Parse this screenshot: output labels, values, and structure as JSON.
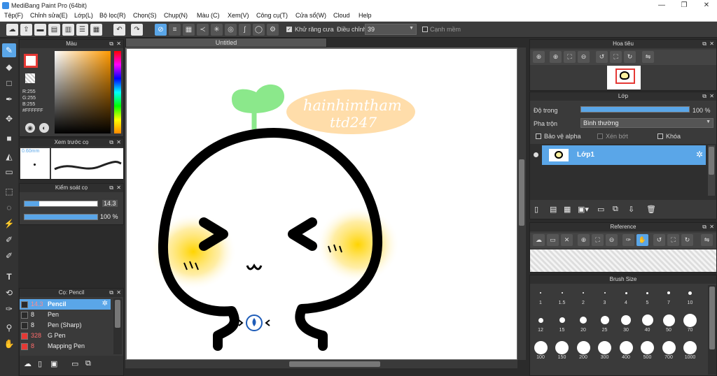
{
  "window": {
    "title": "MediBang Paint Pro (64bit)",
    "minimize": "—",
    "restore": "❐",
    "close": "✕"
  },
  "menu": [
    "Tệp(F)",
    "Chỉnh sửa(E)",
    "Lớp(L)",
    "Bộ lọc(R)",
    "Chọn(S)",
    "Chụp(N)",
    "Màu (C)",
    "Xem(V)",
    "Công cụ(T)",
    "Cửa sổ(W)",
    "Cloud",
    "Help"
  ],
  "toolbar": {
    "antialias_label": "Khử răng cưa",
    "correction_label": "Điều chỉnh",
    "correction_value": "39",
    "smooth_label": "Cạnh mềm"
  },
  "canvas_tab": "Untitled",
  "color_panel": {
    "title": "Màu",
    "r": "R:255",
    "g": "G:255",
    "b": "B:255",
    "hex": "#FFFFFF",
    "fg": "#ffffff",
    "outline": "#e53935"
  },
  "preview_panel": {
    "title": "Xem trước cọ",
    "size": "0.60mm"
  },
  "control_panel": {
    "title": "Kiểm soát cọ",
    "size": "14.3",
    "opacity": "100 %",
    "size_fraction": 0.2,
    "opacity_fraction": 1.0
  },
  "brush_panel": {
    "title": "Cọ: Pencil",
    "items": [
      {
        "size": "14.3",
        "name": "Pencil",
        "color": "#2b2b2b",
        "selected": true
      },
      {
        "size": "8",
        "name": "Pen",
        "color": "#2b2b2b",
        "selected": false
      },
      {
        "size": "8",
        "name": "Pen (Sharp)",
        "color": "#2b2b2b",
        "selected": false
      },
      {
        "size": "328",
        "name": "G Pen",
        "color": "#e53935",
        "selected": false
      },
      {
        "size": "8",
        "name": "Mapping Pen",
        "color": "#e53935",
        "selected": false
      }
    ]
  },
  "navigator": {
    "title": "Hoa tiêu"
  },
  "layer_panel": {
    "title": "Lớp",
    "opacity_label": "Độ trong",
    "opacity_value": "100 %",
    "opacity_fraction": 1.0,
    "blend_label": "Pha trộn",
    "blend_value": "Bình thường",
    "protect_alpha": "Bảo vệ alpha",
    "clipping": "Xén bớt",
    "lock": "Khóa",
    "layer_name": "Lớp1"
  },
  "reference": {
    "title": "Reference"
  },
  "brush_size": {
    "title": "Brush Size",
    "sizes": [
      "1",
      "1.5",
      "2",
      "3",
      "4",
      "5",
      "7",
      "10",
      "12",
      "15",
      "20",
      "25",
      "30",
      "40",
      "50",
      "70",
      "100",
      "150",
      "200",
      "300",
      "400",
      "500",
      "700",
      "1000"
    ]
  },
  "artwork": {
    "text_line1": "hainhimtham",
    "text_line2": "ttd247"
  }
}
